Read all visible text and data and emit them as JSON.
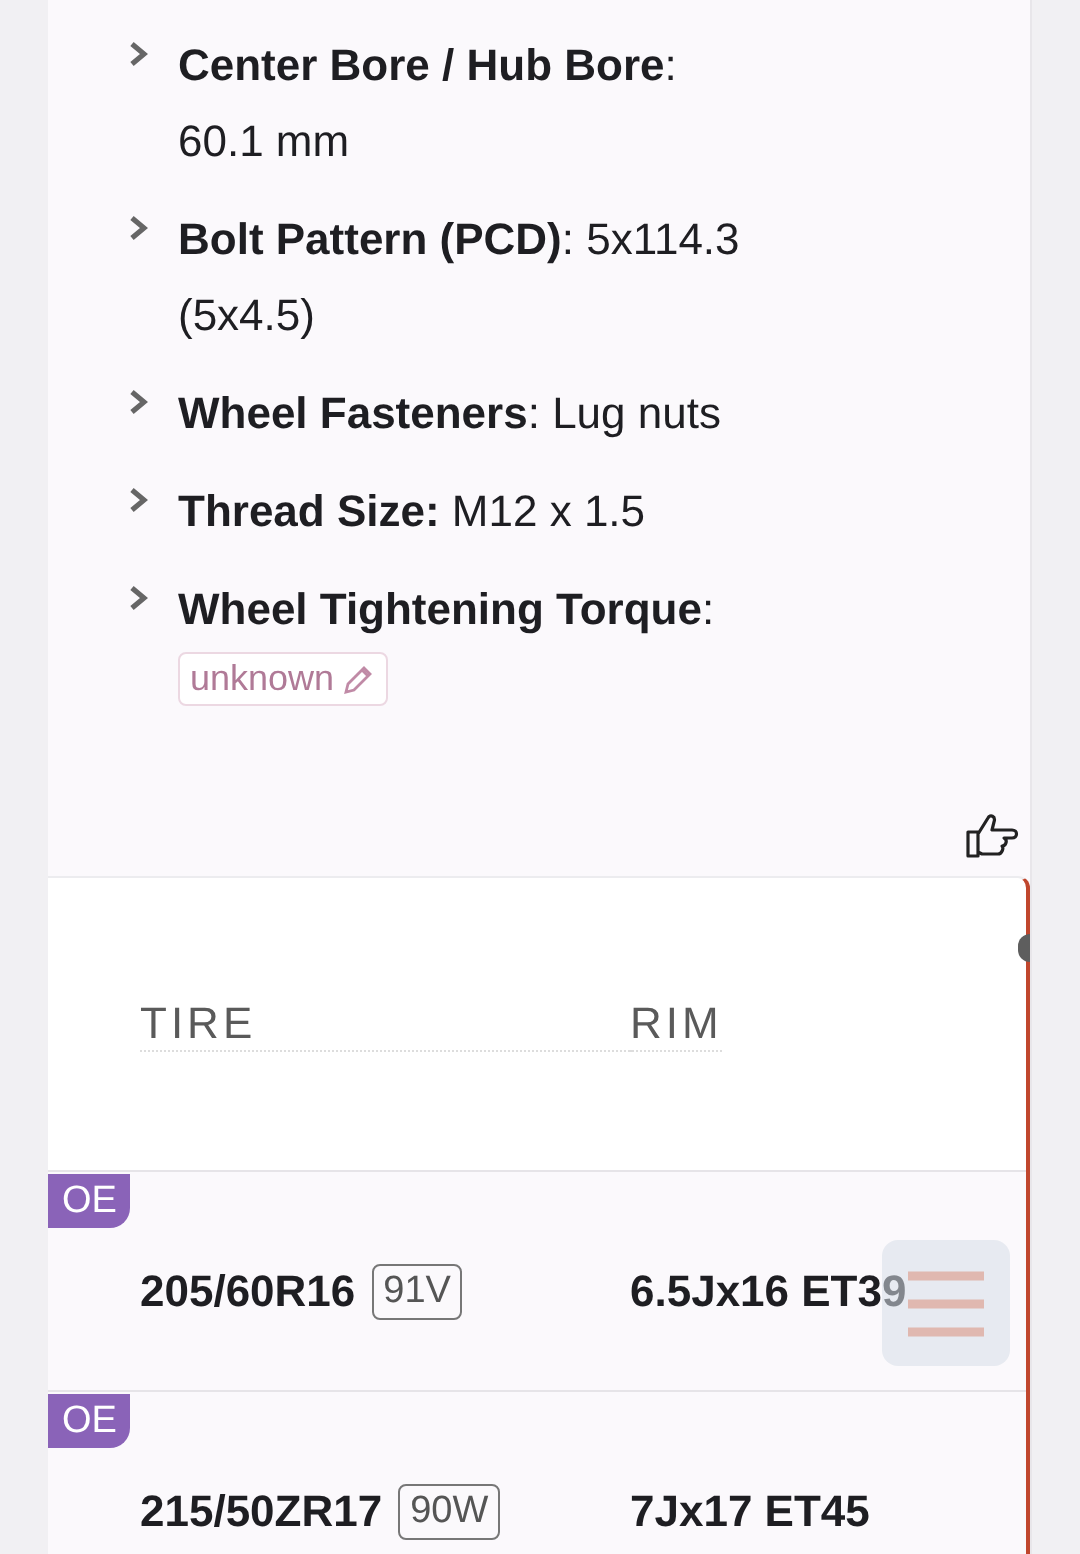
{
  "specs": [
    {
      "kind": "text",
      "text": "**Center Bore / Hub Bore**:\n60.1 mm"
    },
    {
      "kind": "text",
      "text": "**Bolt Pattern (PCD)**: 5x114.3\n(5x4.5)"
    },
    {
      "kind": "text",
      "text": "**Wheel Fasteners**: Lug nuts"
    },
    {
      "kind": "text",
      "text": "**Thread Size:** M12 x 1.5"
    },
    {
      "kind": "badge",
      "text": "**Wheel Tightening Torque**:",
      "badge": "unknown"
    }
  ],
  "table": {
    "columns": [
      "TIRE",
      "RIM"
    ],
    "rows": [
      {
        "tag": "OE",
        "tire": "205/60R16",
        "load": "91V",
        "rim": "6.5Jx16 ET39"
      },
      {
        "tag": "OE",
        "tire": "215/50ZR17",
        "load": "90W",
        "rim": "7Jx17 ET45"
      }
    ]
  }
}
